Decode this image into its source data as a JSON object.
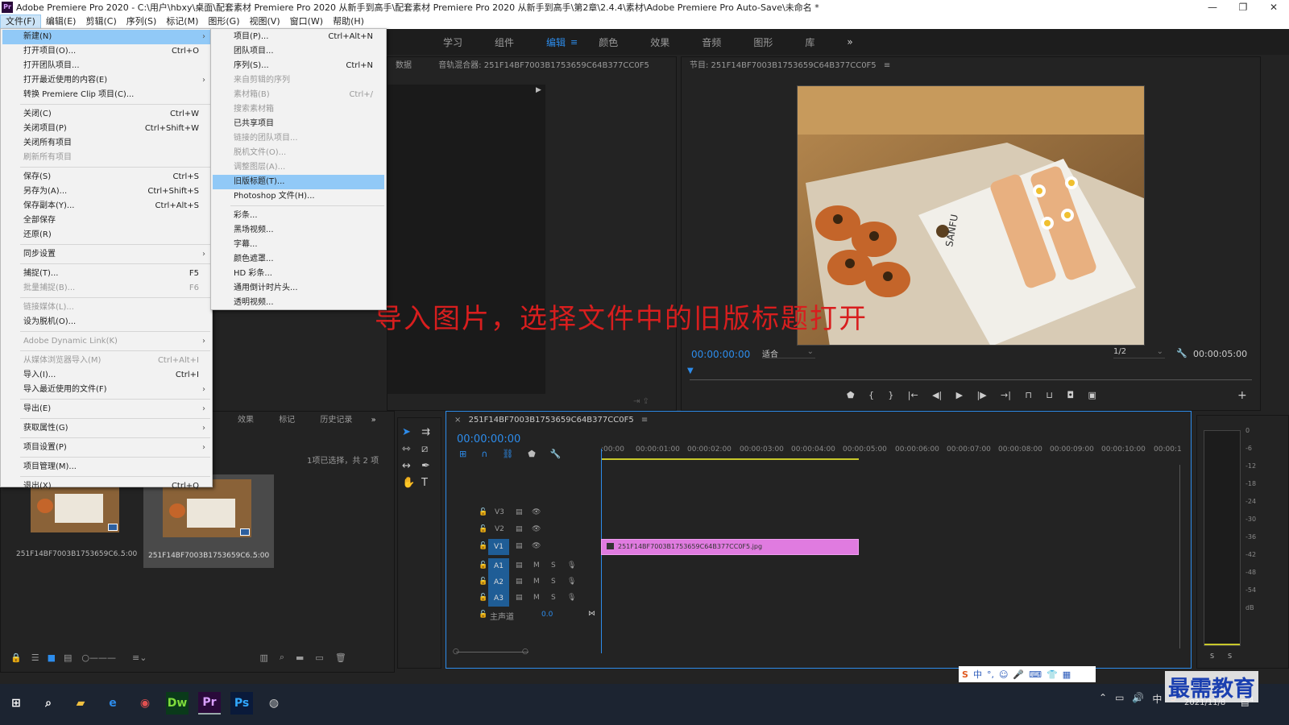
{
  "window": {
    "title": "Adobe Premiere Pro 2020 - C:\\用户\\hbxy\\桌面\\配套素材 Premiere Pro 2020 从新手到高手\\配套素材 Premiere Pro 2020 从新手到高手\\第2章\\2.4.4\\素材\\Adobe Premiere Pro Auto-Save\\未命名 *",
    "logo": "Pr",
    "minimize": "—",
    "restore": "❐",
    "close": "✕"
  },
  "menubar": [
    "文件(F)",
    "编辑(E)",
    "剪辑(C)",
    "序列(S)",
    "标记(M)",
    "图形(G)",
    "视图(V)",
    "窗口(W)",
    "帮助(H)"
  ],
  "workspaces": [
    "学习",
    "组件",
    "编辑",
    "颜色",
    "效果",
    "音频",
    "图形",
    "库"
  ],
  "workspace_active": "编辑",
  "workspace_more": "»",
  "file_menu": [
    {
      "label": "新建(N)",
      "sc": "",
      "arrow": true,
      "hl": true
    },
    {
      "label": "打开项目(O)...",
      "sc": "Ctrl+O"
    },
    {
      "label": "打开团队项目..."
    },
    {
      "label": "打开最近使用的内容(E)",
      "arrow": true
    },
    {
      "label": "转换 Premiere Clip 项目(C)..."
    },
    {
      "label": "关闭(C)",
      "sc": "Ctrl+W"
    },
    {
      "label": "关闭项目(P)",
      "sc": "Ctrl+Shift+W"
    },
    {
      "label": "关闭所有项目"
    },
    {
      "label": "刷新所有项目",
      "disabled": true
    },
    {
      "label": "保存(S)",
      "sc": "Ctrl+S"
    },
    {
      "label": "另存为(A)...",
      "sc": "Ctrl+Shift+S"
    },
    {
      "label": "保存副本(Y)...",
      "sc": "Ctrl+Alt+S"
    },
    {
      "label": "全部保存"
    },
    {
      "label": "还原(R)"
    },
    {
      "label": "同步设置",
      "arrow": true
    },
    {
      "label": "捕捉(T)...",
      "sc": "F5"
    },
    {
      "label": "批量捕捉(B)...",
      "sc": "F6",
      "disabled": true
    },
    {
      "label": "链接媒体(L)...",
      "disabled": true
    },
    {
      "label": "设为脱机(O)..."
    },
    {
      "label": "Adobe Dynamic Link(K)",
      "arrow": true,
      "disabled": true
    },
    {
      "label": "从媒体浏览器导入(M)",
      "sc": "Ctrl+Alt+I",
      "disabled": true
    },
    {
      "label": "导入(I)...",
      "sc": "Ctrl+I"
    },
    {
      "label": "导入最近使用的文件(F)",
      "arrow": true
    },
    {
      "label": "导出(E)",
      "arrow": true
    },
    {
      "label": "获取属性(G)",
      "arrow": true
    },
    {
      "label": "项目设置(P)",
      "arrow": true
    },
    {
      "label": "项目管理(M)..."
    },
    {
      "label": "退出(X)",
      "sc": "Ctrl+Q"
    }
  ],
  "new_menu": [
    {
      "label": "项目(P)...",
      "sc": "Ctrl+Alt+N"
    },
    {
      "label": "团队项目..."
    },
    {
      "label": "序列(S)...",
      "sc": "Ctrl+N"
    },
    {
      "label": "来自剪辑的序列",
      "disabled": true
    },
    {
      "label": "素材箱(B)",
      "sc": "Ctrl+/",
      "disabled": true
    },
    {
      "label": "搜索素材箱",
      "disabled": true
    },
    {
      "label": "已共享项目"
    },
    {
      "label": "链接的团队项目...",
      "disabled": true
    },
    {
      "label": "脱机文件(O)...",
      "disabled": true
    },
    {
      "label": "调整图层(A)...",
      "disabled": true
    },
    {
      "label": "旧版标题(T)...",
      "hl": true
    },
    {
      "label": "Photoshop 文件(H)..."
    },
    {
      "label": "彩条..."
    },
    {
      "label": "黑场视频..."
    },
    {
      "label": "字幕..."
    },
    {
      "label": "颜色遮罩..."
    },
    {
      "label": "HD 彩条..."
    },
    {
      "label": "通用倒计时片头..."
    },
    {
      "label": "透明视频..."
    }
  ],
  "source_panel": {
    "tab_partial": "数据",
    "audio_mixer": "音轨混合器: 251F14BF7003B1753659C64B377CC0F5"
  },
  "program_panel": {
    "title": "节目: 251F14BF7003B1753659C64B377CC0F5",
    "menu_icon": "≡",
    "timecode": "00:00:00:00",
    "fit": "适合",
    "res": "1/2",
    "duration": "00:00:05:00",
    "video_labels": {
      "brand": "SANFU"
    }
  },
  "overlay_text": "导入图片，选择文件中的旧版标题打开",
  "project_panel": {
    "tabs": [
      "效果",
      "标记",
      "历史记录"
    ],
    "more": "»",
    "selection_info": "1项已选择，共 2 项",
    "clips": [
      {
        "name": "251F14BF7003B1753659C6...",
        "duration": "5:00"
      },
      {
        "name": "251F14BF7003B1753659C6...",
        "duration": "5:00"
      }
    ]
  },
  "timeline": {
    "tab": "251F14BF7003B1753659C64B377CC0F5",
    "close": "×",
    "menu_icon": "≡",
    "timecode": "00:00:00:00",
    "ruler": [
      ":00:00",
      "00:00:01:00",
      "00:00:02:00",
      "00:00:03:00",
      "00:00:04:00",
      "00:00:05:00",
      "00:00:06:00",
      "00:00:07:00",
      "00:00:08:00",
      "00:00:09:00",
      "00:00:10:00",
      "00:00:1"
    ],
    "video_tracks": [
      "V3",
      "V2",
      "V1"
    ],
    "audio_tracks": [
      "A1",
      "A2",
      "A3"
    ],
    "master": "主声道",
    "master_val": "0.0",
    "clip_name": "251F14BF7003B1753659C64B377CC0F5.jpg",
    "mute": "M",
    "solo": "S"
  },
  "meter": {
    "ticks": [
      "0",
      "-6",
      "-12",
      "-18",
      "-24",
      "-30",
      "-36",
      "-42",
      "-48",
      "-54",
      "dB"
    ],
    "s_labels": [
      "S",
      "S"
    ]
  },
  "taskbar": {
    "clock_time": "",
    "date": "2021/11/8",
    "watermark": "最需教育",
    "apps": [
      "Dw",
      "Pr",
      "Ps"
    ],
    "ime": "中",
    "notif": "4"
  },
  "colors": {
    "accent": "#2d8ceb",
    "clip": "#e07be0",
    "highlight": "#91c9f7",
    "overlay_red": "#d81e1e"
  }
}
